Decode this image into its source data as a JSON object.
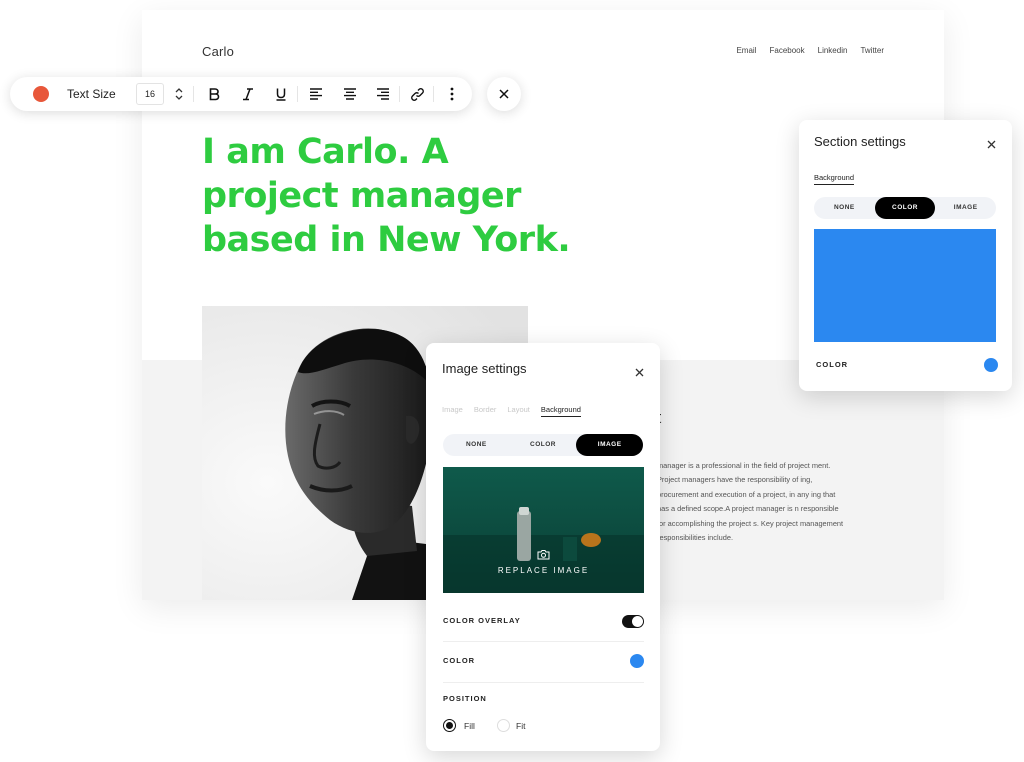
{
  "site": {
    "logo": "Carlo",
    "nav": [
      "Email",
      "Facebook",
      "Linkedin",
      "Twitter"
    ],
    "hero": "I am Carlo. A project manager based in New York.",
    "about_title": "ut",
    "about_text": "manager is a professional in the field of project ment. Project managers have the responsibility of ing, procurement and execution of a project, in any ing that has a defined scope.A project manager is n responsible for accomplishing the project s. Key project management responsibilities include."
  },
  "toolbar": {
    "text_color": "#e8573a",
    "size_label": "Text Size",
    "size_value": "16",
    "icons": [
      "bold-icon",
      "italic-icon",
      "underline-icon",
      "align-left-icon",
      "align-center-icon",
      "align-right-icon",
      "link-icon",
      "more-icon",
      "close-icon"
    ]
  },
  "section_settings": {
    "title": "Section settings",
    "tab": "Background",
    "segments": [
      "NONE",
      "COLOR",
      "IMAGE"
    ],
    "active_segment": "COLOR",
    "swatch_color": "#2b88f0",
    "color_label": "COLOR",
    "color_value": "#2b88f0"
  },
  "image_settings": {
    "title": "Image settings",
    "tabs": [
      "Image",
      "Border",
      "Layout",
      "Background"
    ],
    "active_tab": "Background",
    "segments": [
      "NONE",
      "COLOR",
      "IMAGE"
    ],
    "active_segment": "IMAGE",
    "replace_label": "REPLACE IMAGE",
    "overlay_label": "COLOR OVERLAY",
    "overlay_on": true,
    "color_label": "COLOR",
    "color_value": "#2b88f0",
    "position_label": "POSITION",
    "position_options": [
      "Fill",
      "Fit"
    ],
    "position_selected": "Fill"
  },
  "colors": {
    "hero_green": "#2ecc40",
    "accent_blue": "#2b88f0",
    "thumb_green": "#0f4f42"
  }
}
